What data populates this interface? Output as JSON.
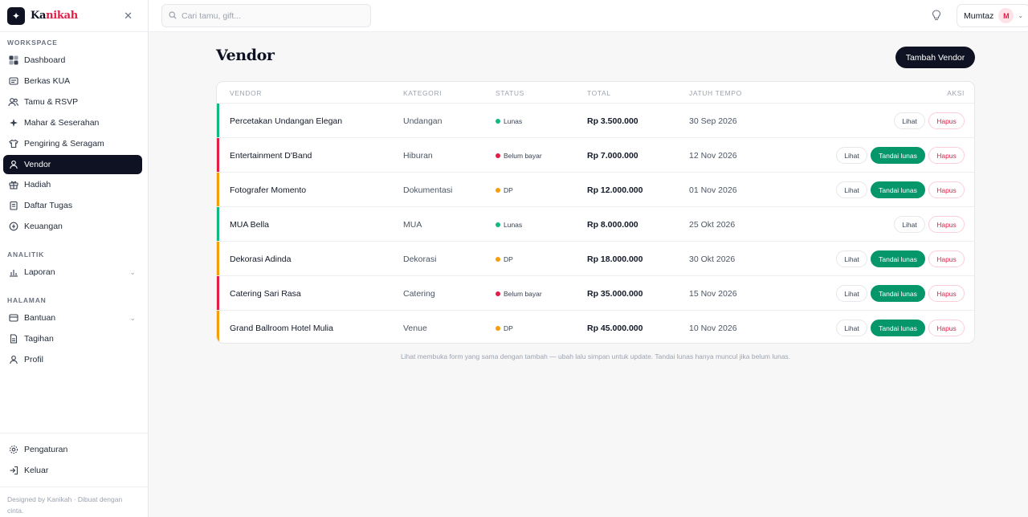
{
  "brand": {
    "name_prefix": "Ka",
    "name_accent": "nikah"
  },
  "search": {
    "placeholder": "Cari tamu, gift..."
  },
  "user": {
    "name": "Mumtaz",
    "initial": "M"
  },
  "sidebar": {
    "sections": {
      "workspace": "WORKSPACE",
      "analytics": "ANALITIK",
      "pages": "HALAMAN"
    },
    "workspace_items": [
      {
        "label": "Dashboard",
        "icon": "dashboard-icon"
      },
      {
        "label": "Berkas KUA",
        "icon": "document-icon"
      },
      {
        "label": "Tamu & RSVP",
        "icon": "users-icon"
      },
      {
        "label": "Mahar & Seserahan",
        "icon": "sparkle-icon"
      },
      {
        "label": "Pengiring & Seragam",
        "icon": "shirt-icon"
      },
      {
        "label": "Vendor",
        "icon": "user-icon",
        "active": true
      },
      {
        "label": "Hadiah",
        "icon": "gift-icon"
      },
      {
        "label": "Daftar Tugas",
        "icon": "checklist-icon"
      },
      {
        "label": "Keuangan",
        "icon": "money-icon"
      }
    ],
    "analytics_items": [
      {
        "label": "Laporan",
        "icon": "chart-icon"
      }
    ],
    "page_items": [
      {
        "label": "Bantuan",
        "icon": "help-icon"
      },
      {
        "label": "Tagihan",
        "icon": "invoice-icon"
      },
      {
        "label": "Profil",
        "icon": "profile-icon"
      }
    ],
    "bottom_items": [
      {
        "label": "Pengaturan",
        "icon": "settings-icon"
      },
      {
        "label": "Keluar",
        "icon": "logout-icon"
      }
    ],
    "footer": "Designed by Kanikah · Dibuat dengan cinta."
  },
  "main": {
    "title": "Vendor",
    "add_button": "Tambah Vendor",
    "columns": {
      "vendor": "VENDOR",
      "category": "KATEGORI",
      "status": "STATUS",
      "total": "TOTAL",
      "due": "JATUH TEMPO",
      "actions": "AKSI"
    },
    "action_labels": {
      "view": "Lihat",
      "mark_paid": "Tandai lunas",
      "delete": "Hapus"
    },
    "rows": [
      {
        "vendor": "Percetakan Undangan Elegan",
        "category": "Undangan",
        "status": "Lunas",
        "total": "Rp 3.500.000",
        "due": "30 Sep 2026"
      },
      {
        "vendor": "Entertainment D'Band",
        "category": "Hiburan",
        "status": "Belum bayar",
        "total": "Rp 7.000.000",
        "due": "12 Nov 2026"
      },
      {
        "vendor": "Fotografer Momento",
        "category": "Dokumentasi",
        "status": "DP",
        "total": "Rp 12.000.000",
        "due": "01 Nov 2026"
      },
      {
        "vendor": "MUA Bella",
        "category": "MUA",
        "status": "Lunas",
        "total": "Rp 8.000.000",
        "due": "25 Okt 2026"
      },
      {
        "vendor": "Dekorasi Adinda",
        "category": "Dekorasi",
        "status": "DP",
        "total": "Rp 18.000.000",
        "due": "30 Okt 2026"
      },
      {
        "vendor": "Catering Sari Rasa",
        "category": "Catering",
        "status": "Belum bayar",
        "total": "Rp 35.000.000",
        "due": "15 Nov 2026"
      },
      {
        "vendor": "Grand Ballroom Hotel Mulia",
        "category": "Venue",
        "status": "DP",
        "total": "Rp 45.000.000",
        "due": "10 Nov 2026"
      }
    ],
    "status_colors": {
      "Lunas": "#10b981",
      "Belum bayar": "#e11d48",
      "DP": "#f59e0b"
    },
    "note": "Lihat membuka form yang sama dengan tambah — ubah lalu simpan untuk update. Tandai lunas hanya muncul jika belum lunas."
  }
}
